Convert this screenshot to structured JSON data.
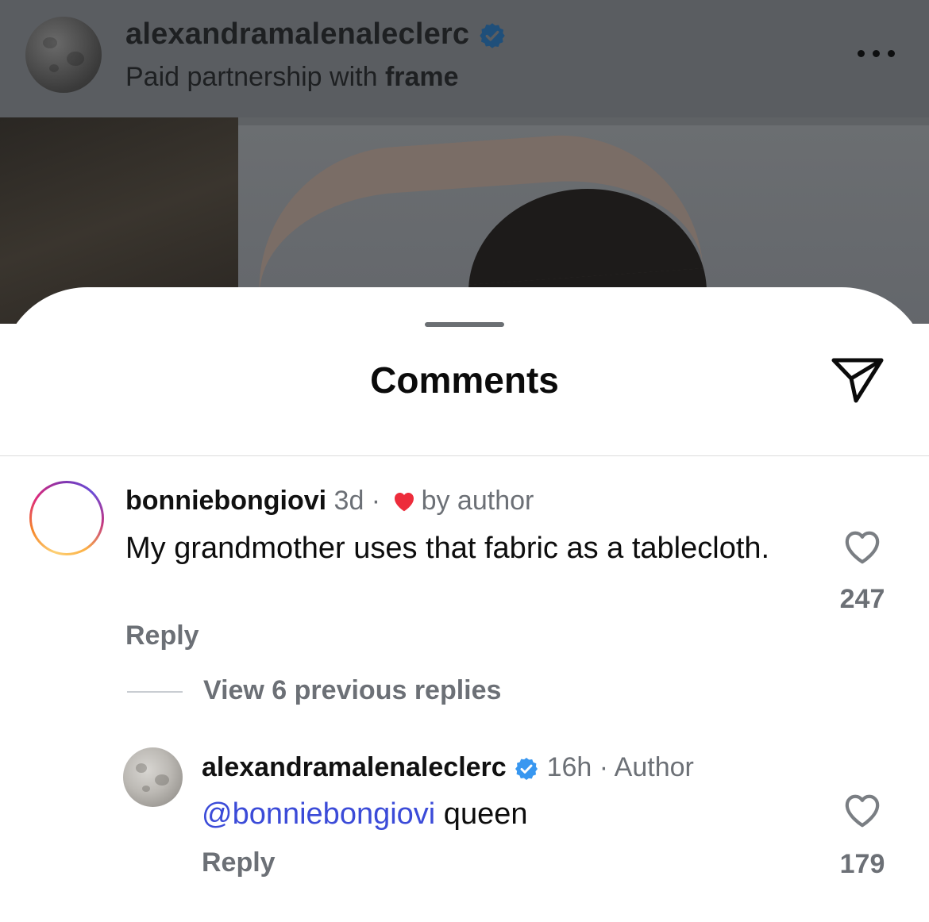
{
  "post": {
    "username": "alexandramalenaleclerc",
    "subtitle_prefix": "Paid partnership with",
    "subtitle_brand": "frame"
  },
  "sheet": {
    "title": "Comments"
  },
  "comments": [
    {
      "username": "bonniebongiovi",
      "time": "3d ·",
      "liked_by_author_label": "by author",
      "text": "My grandmother uses that fabric as a tablecloth.",
      "reply_label": "Reply",
      "like_count": "247"
    }
  ],
  "view_replies_label": "View 6 previous replies",
  "replies": [
    {
      "username": "alexandramalenaleclerc",
      "time": "16h · Author",
      "mention": "@bonniebongiovi",
      "text": " queen",
      "reply_label": "Reply",
      "like_count": "179"
    }
  ],
  "colors": {
    "verified": "#3897f0",
    "like_heart_red": "#ed2c3b",
    "mention": "#3b4bd8",
    "dim_overlay": "#5a5d61"
  },
  "icons": [
    "verified-badge-icon",
    "more-options-icon",
    "share-icon",
    "heart-icon",
    "like-heart-outline-icon"
  ]
}
